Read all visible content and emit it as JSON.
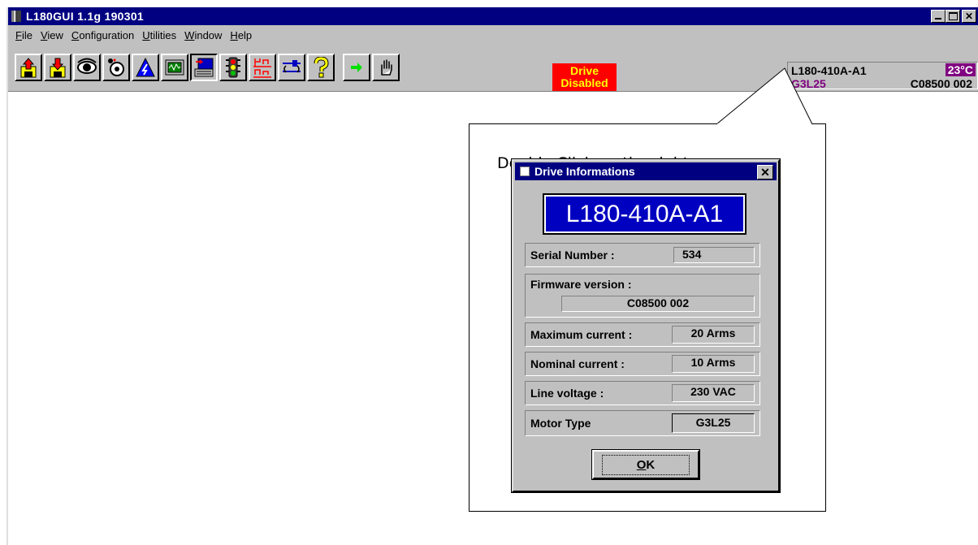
{
  "window": {
    "title": "L180GUI   1.1g 190301",
    "controls": [
      "minimize",
      "maximize",
      "close"
    ]
  },
  "menu": {
    "items": [
      {
        "label": "File",
        "accel": "F"
      },
      {
        "label": "View",
        "accel": "V"
      },
      {
        "label": "Configuration",
        "accel": "C"
      },
      {
        "label": "Utilities",
        "accel": "U"
      },
      {
        "label": "Window",
        "accel": "W"
      },
      {
        "label": "Help",
        "accel": "H"
      }
    ]
  },
  "toolbar": {
    "buttons": [
      {
        "name": "upload-icon"
      },
      {
        "name": "download-icon"
      },
      {
        "name": "eye-icon"
      },
      {
        "name": "tuning-icon"
      },
      {
        "name": "triangle-icon"
      },
      {
        "name": "scope-icon"
      },
      {
        "name": "terminal-icon"
      },
      {
        "name": "traffic-light-icon"
      },
      {
        "name": "io-icon"
      },
      {
        "name": "switch-icon"
      },
      {
        "name": "question-icon"
      },
      {
        "name": "arrow-right-icon"
      },
      {
        "name": "hand-icon"
      }
    ],
    "drive_status_line1": "Drive",
    "drive_status_line2": "Disabled",
    "drive_status_color": "#ff0000"
  },
  "status_panel": {
    "model": "L180-410A-A1",
    "temperature": "23°C",
    "motor": "G3L25",
    "firmware": "C08500 002"
  },
  "annotation": {
    "text": "Double Click on the right corner"
  },
  "dialog": {
    "title": "Drive Informations",
    "model": "L180-410A-A1",
    "serial_label": "Serial Number :",
    "serial_value": "534",
    "firmware_label": "Firmware version :",
    "firmware_value": "C08500 002",
    "max_current_label": "Maximum current :",
    "max_current_value": "20 Arms",
    "nominal_current_label": "Nominal current :",
    "nominal_current_value": "10 Arms",
    "line_voltage_label": "Line voltage :",
    "line_voltage_value": "230 VAC",
    "motor_type_label": "Motor Type",
    "motor_type_value": "G3L25",
    "ok_label": "OK"
  }
}
